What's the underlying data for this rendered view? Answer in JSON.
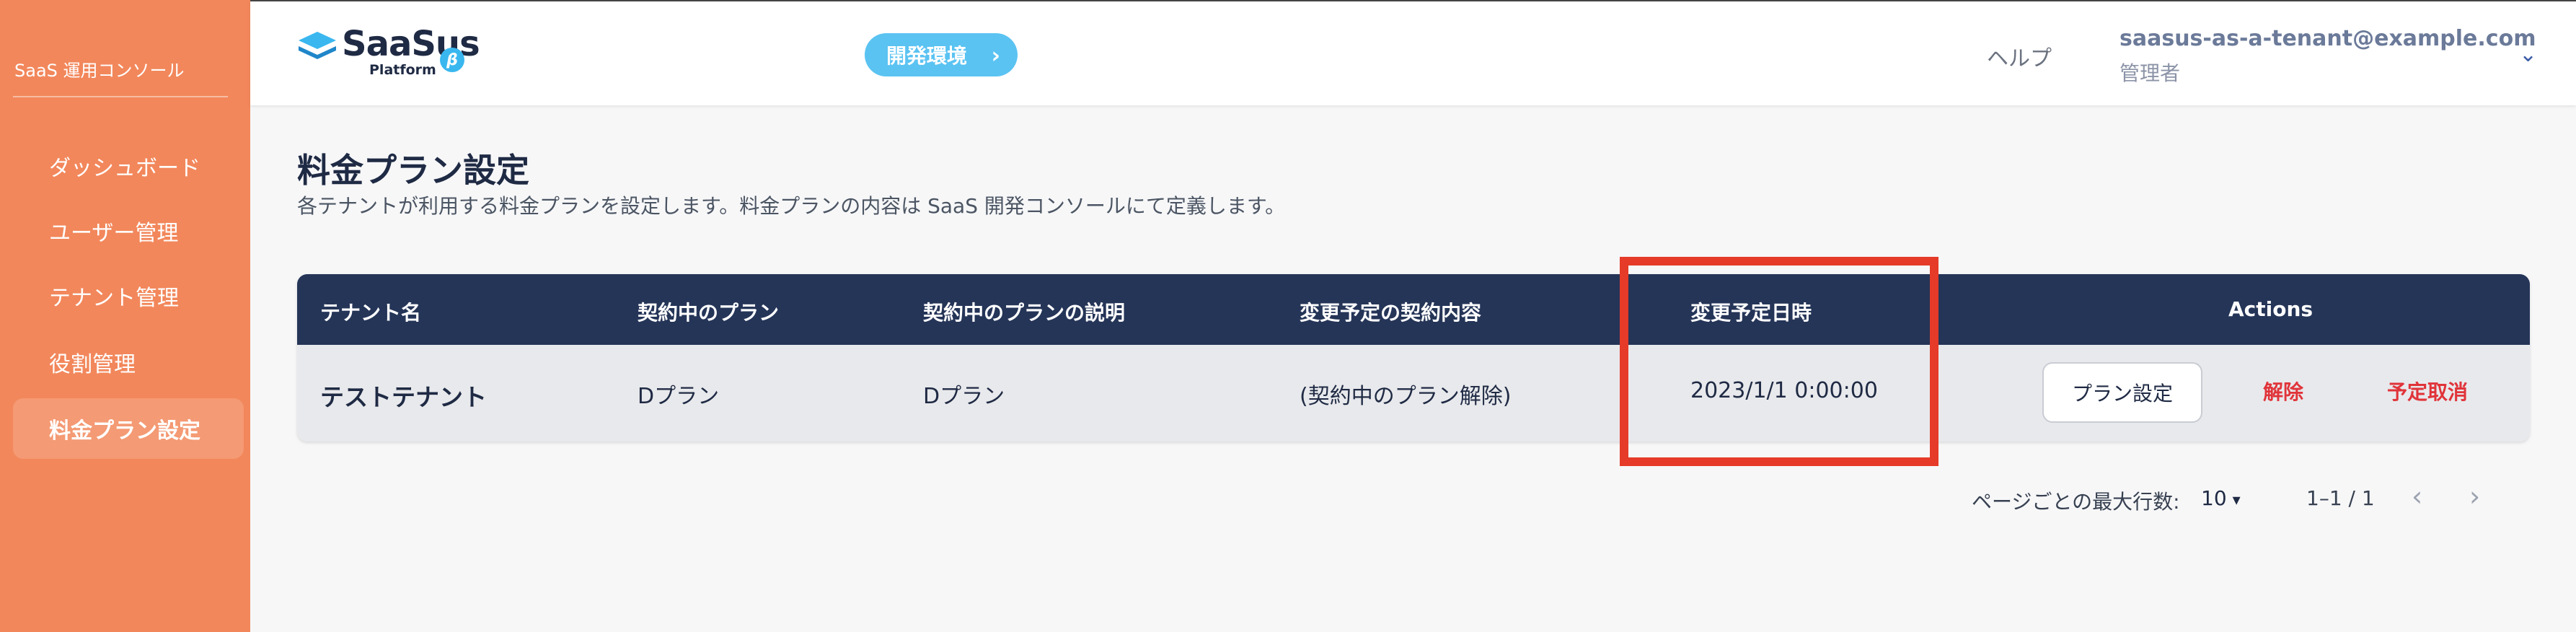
{
  "sidebar": {
    "title": "SaaS 運用コンソール",
    "items": [
      {
        "label": "ダッシュボード"
      },
      {
        "label": "ユーザー管理"
      },
      {
        "label": "テナント管理"
      },
      {
        "label": "役割管理"
      },
      {
        "label": "料金プラン設定",
        "active": true
      }
    ]
  },
  "header": {
    "logo_name": "SaaSus",
    "logo_sub": "Platform",
    "logo_badge": "β",
    "env_button": "開発環境",
    "env_chevron": "›",
    "help": "ヘルプ",
    "user_email": "saasus-as-a-tenant@example.com",
    "user_role": "管理者",
    "user_menu_icon": "⌄"
  },
  "page": {
    "title": "料金プラン設定",
    "description": "各テナントが利用する料金プランを設定します。料金プランの内容は SaaS 開発コンソールにて定義します。"
  },
  "table": {
    "columns": [
      "テナント名",
      "契約中のプラン",
      "契約中のプランの説明",
      "変更予定の契約内容",
      "変更予定日時",
      "Actions"
    ],
    "rows": [
      {
        "tenant_name": "テストテナント",
        "current_plan": "Dプラン",
        "current_plan_desc": "Dプラン",
        "scheduled_change": "(契約中のプラン解除)",
        "scheduled_date": "2023/1/1 0:00:00",
        "action_plan": "プラン設定",
        "action_cancel": "解除",
        "action_cancel_schedule": "予定取消"
      }
    ]
  },
  "pagination": {
    "rows_per_page_label": "ページごとの最大行数:",
    "rows_per_page": "10",
    "caret": "▾",
    "range": "1–1 / 1",
    "prev": "‹",
    "next": "›"
  },
  "colors": {
    "sidebar": "#f2875b",
    "table_header": "#253558",
    "accent_blue": "#5ac3f2",
    "danger": "#e0343a",
    "highlight": "#e53b28"
  }
}
